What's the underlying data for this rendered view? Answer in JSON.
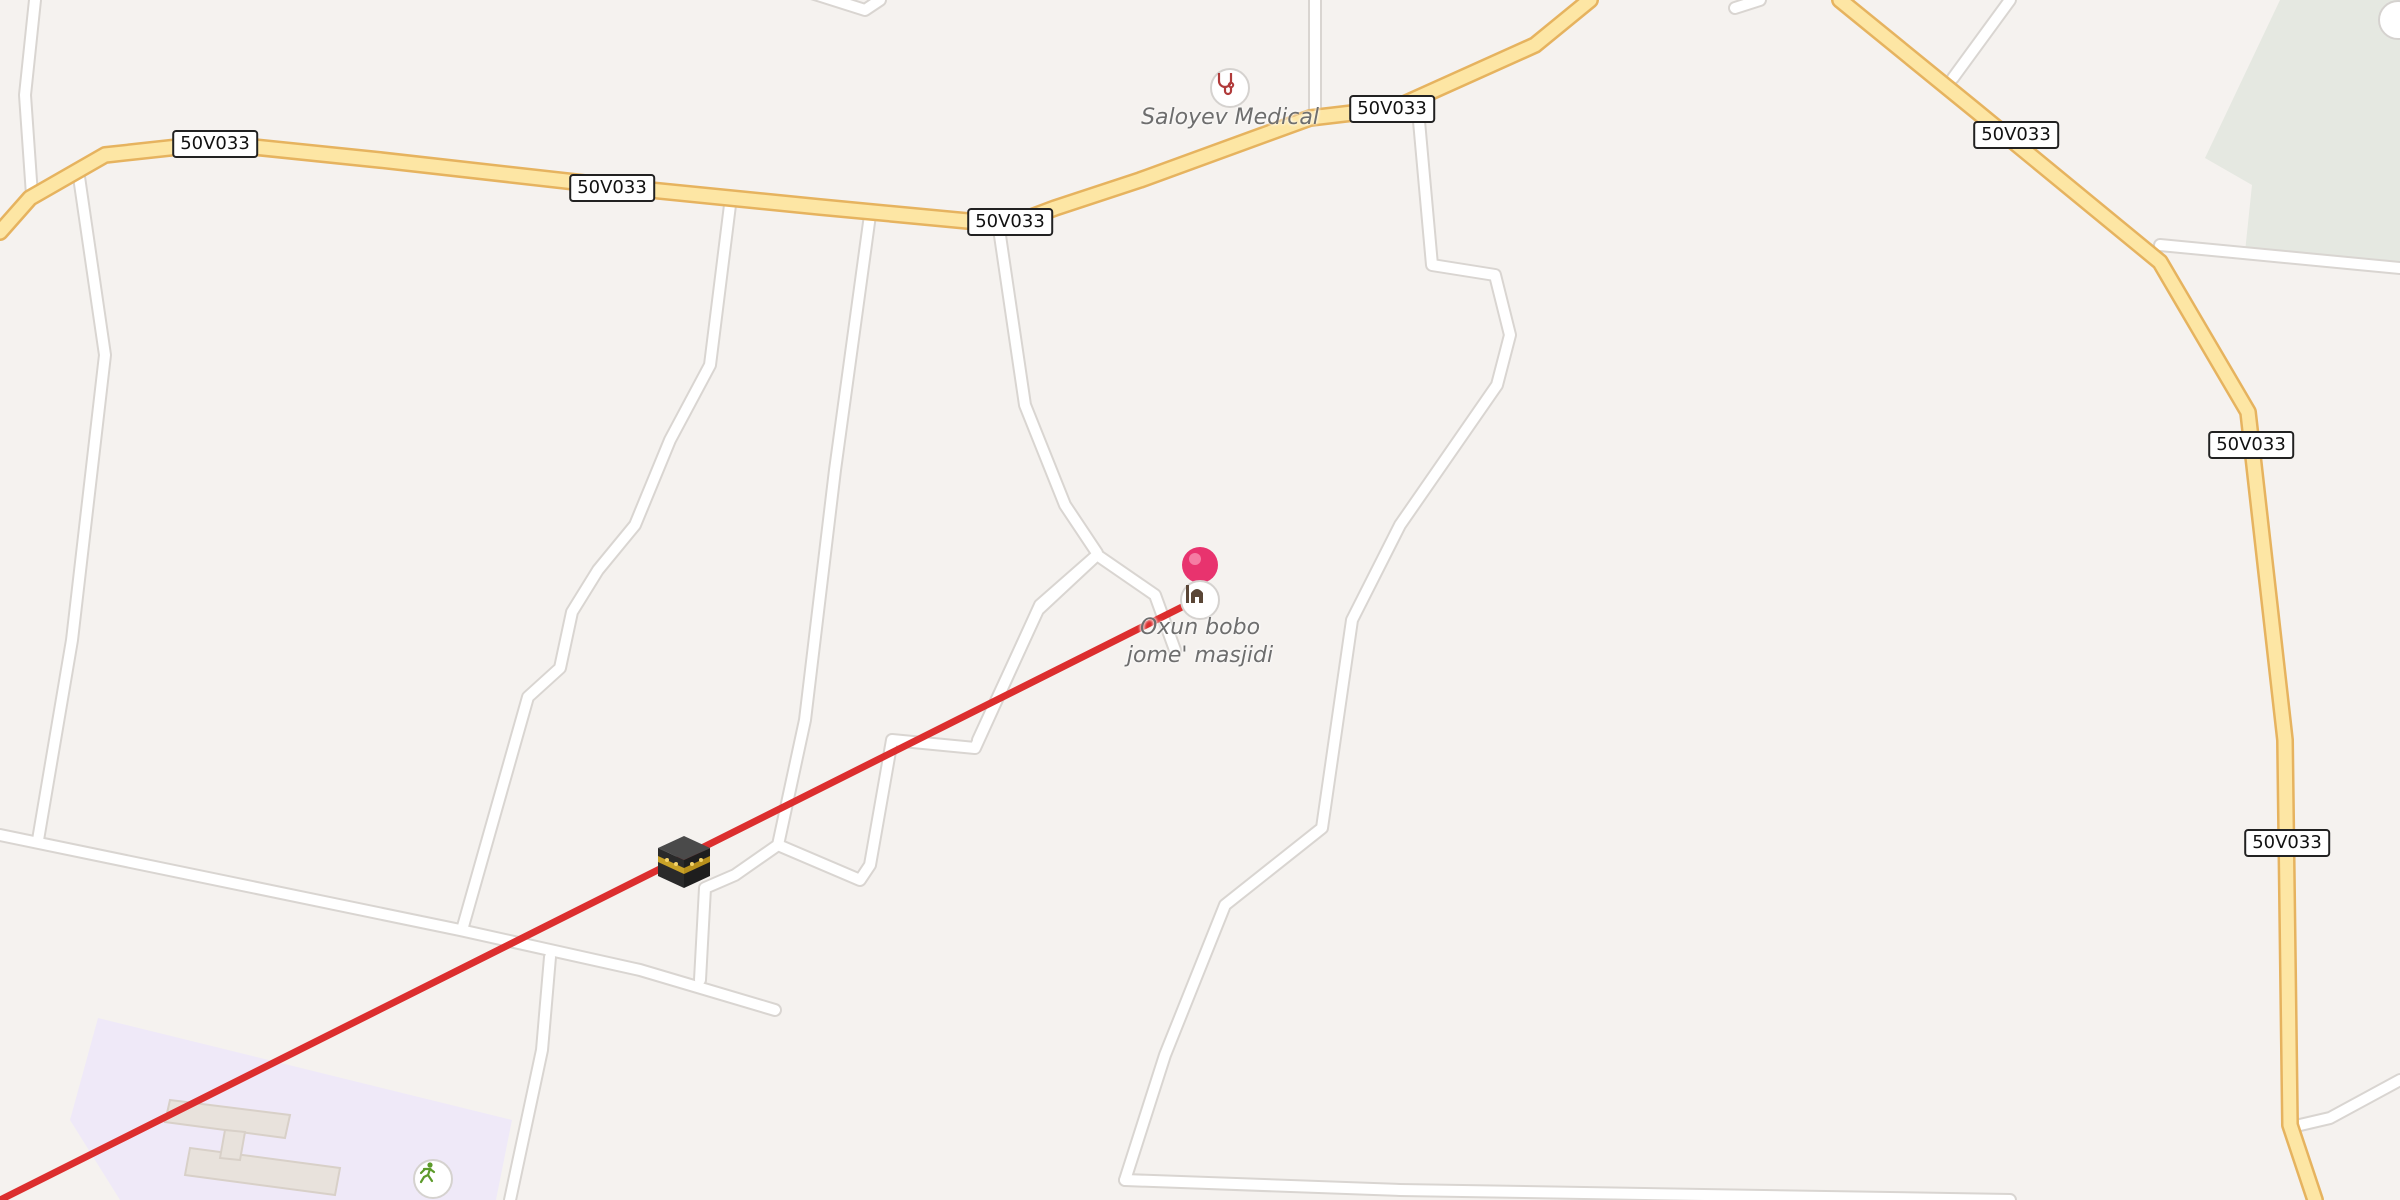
{
  "map": {
    "road_ref": "50V033",
    "road_shields": [
      "50V033",
      "50V033",
      "50V033",
      "50V033",
      "50V033",
      "50V033",
      "50V033"
    ],
    "pois": {
      "medical": {
        "name": "Saloyev Medical",
        "icon": "medical-icon"
      },
      "mosque": {
        "name_line1": "Oxun bobo",
        "name_line2": "jome' masjidi",
        "icon": "mosque-icon"
      },
      "sports": {
        "icon": "sports-icon"
      }
    },
    "markers": {
      "location_pin": {
        "icon": "location-pin-icon",
        "color": "#e8336e"
      },
      "qibla_kaaba": {
        "icon": "kaaba-icon"
      }
    },
    "qibla_line": {
      "color": "#dc2e2e"
    },
    "colors": {
      "background": "#f5f2ef",
      "minor_road": "#ffffff",
      "minor_road_casing": "#d9d5d1",
      "major_road": "#fde6a4",
      "major_road_casing": "#e6b35f",
      "park": "#e5e8e1",
      "school_area": "#efe9f8"
    }
  }
}
